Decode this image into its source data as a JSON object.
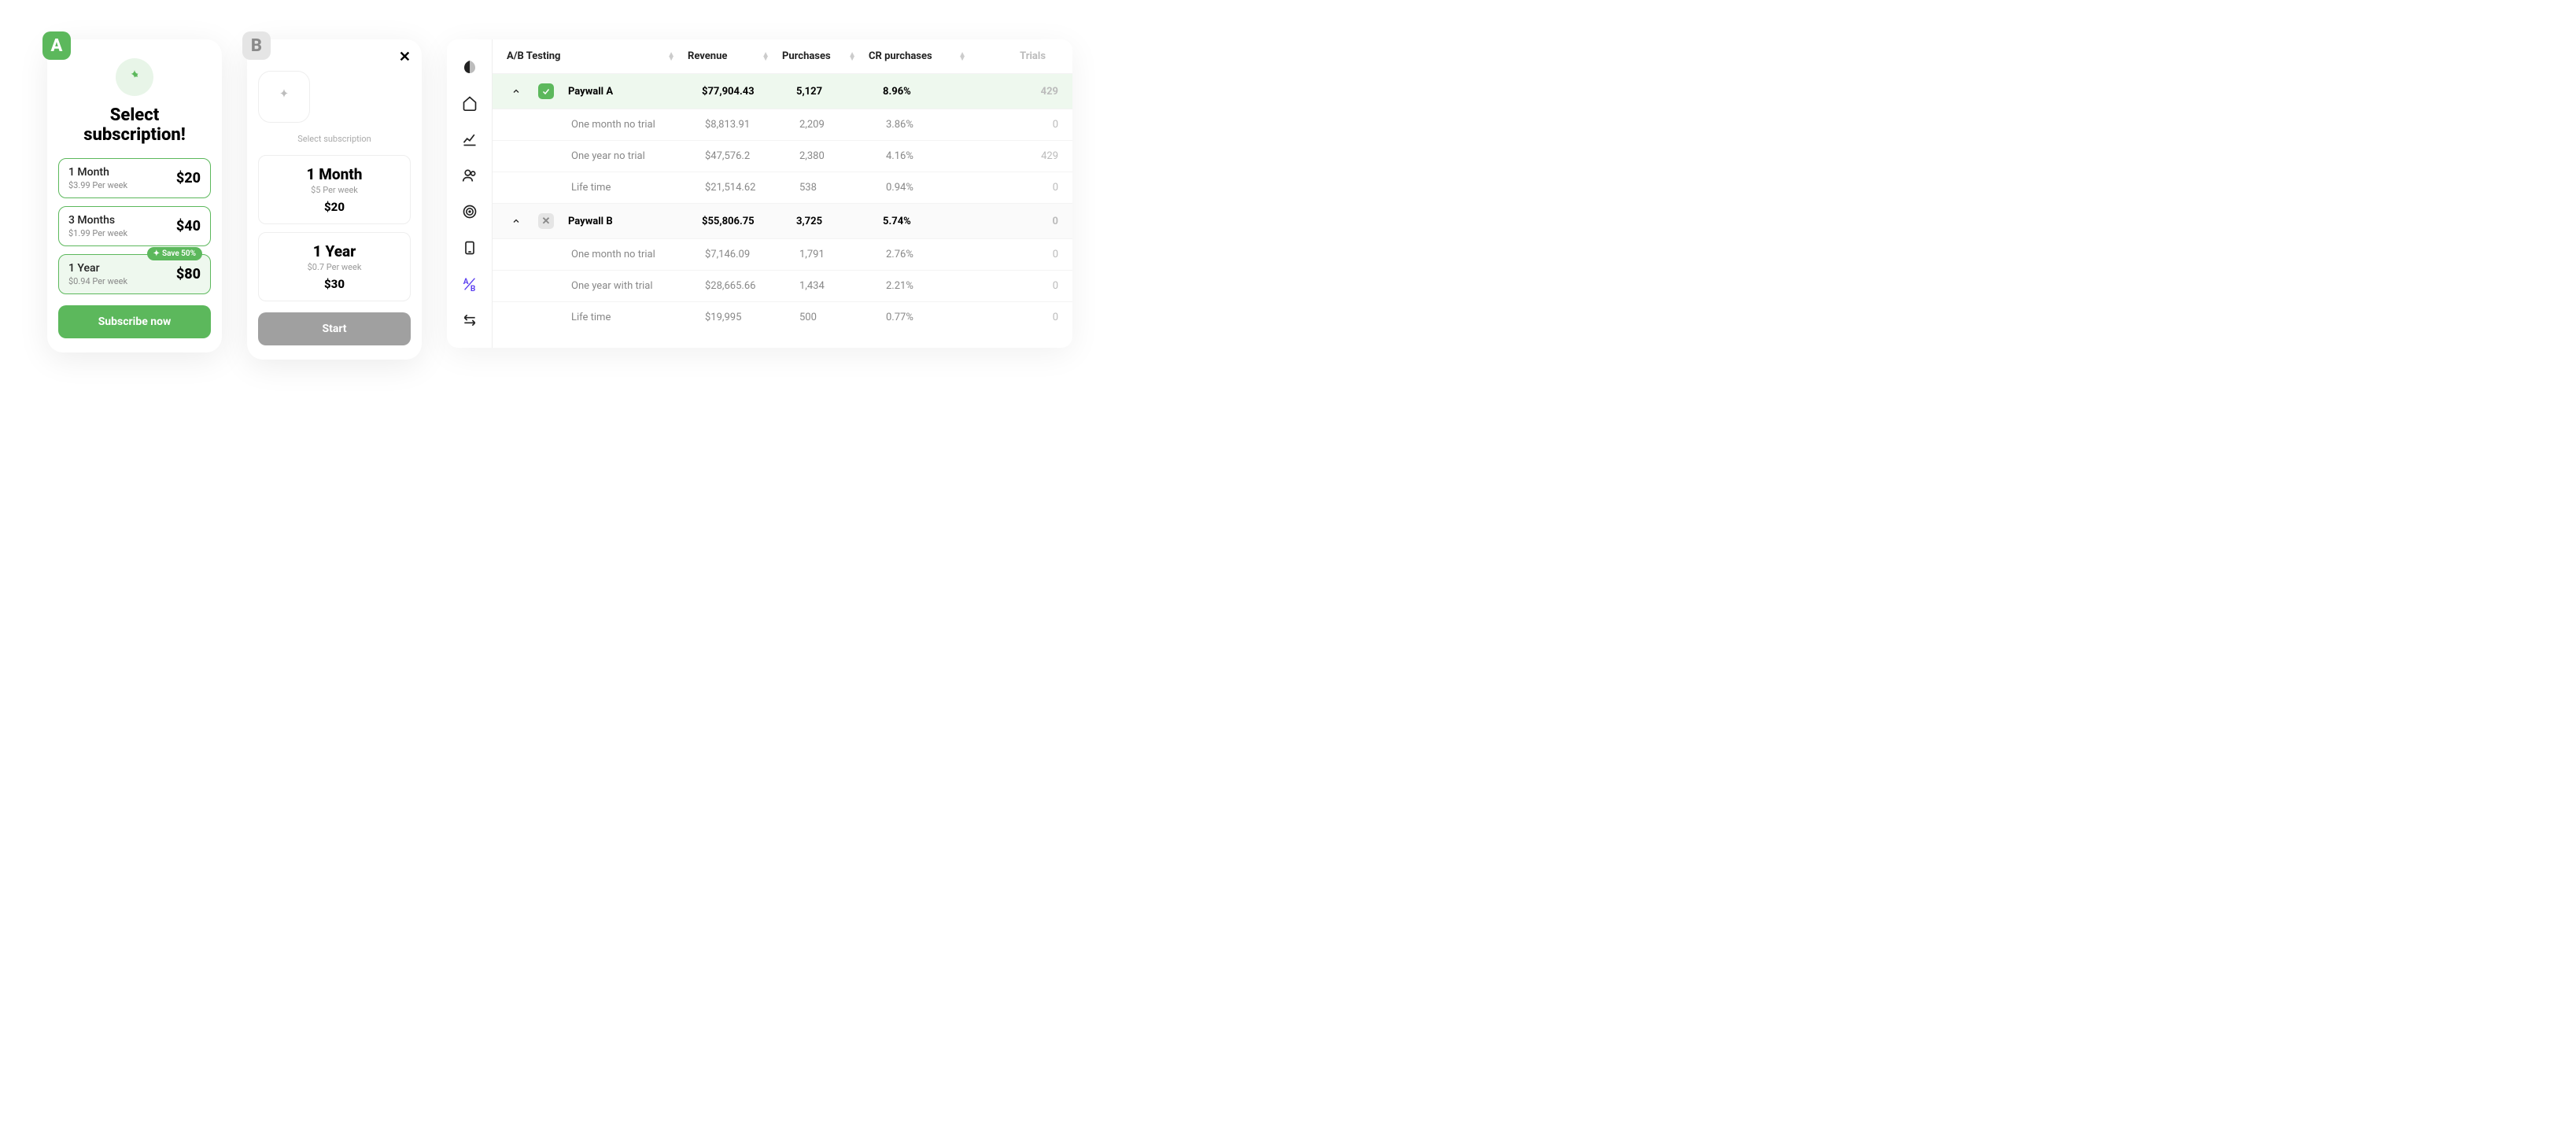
{
  "variant_a": {
    "badge": "A",
    "title_line1": "Select",
    "title_line2": "subscription!",
    "plans": [
      {
        "name": "1 Month",
        "per": "$3.99 Per week",
        "price": "$20"
      },
      {
        "name": "3 Months",
        "per": "$1.99 Per week",
        "price": "$40"
      },
      {
        "name": "1 Year",
        "per": "$0.94 Per week",
        "price": "$80",
        "save": "Save 50%"
      }
    ],
    "cta": "Subscribe now"
  },
  "variant_b": {
    "badge": "B",
    "subtitle": "Select subscription",
    "plans": [
      {
        "name": "1 Month",
        "per": "$5 Per week",
        "price": "$20"
      },
      {
        "name": "1 Year",
        "per": "$0.7 Per week",
        "price": "$30"
      }
    ],
    "cta": "Start"
  },
  "dashboard": {
    "headers": {
      "name": "A/B Testing",
      "rev": "Revenue",
      "pur": "Purchases",
      "cr": "CR purchases",
      "tr": "Trials"
    },
    "groups": [
      {
        "label": "Paywall A",
        "rev": "$77,904.43",
        "pur": "5,127",
        "cr": "8.96%",
        "tr": "429",
        "active": true,
        "rows": [
          {
            "name": "One month no trial",
            "rev": "$8,813.91",
            "pur": "2,209",
            "cr": "3.86%",
            "tr": "0"
          },
          {
            "name": "One year no trial",
            "rev": "$47,576.2",
            "pur": "2,380",
            "cr": "4.16%",
            "tr": "429"
          },
          {
            "name": "Life time",
            "rev": "$21,514.62",
            "pur": "538",
            "cr": "0.94%",
            "tr": "0"
          }
        ]
      },
      {
        "label": "Paywall B",
        "rev": "$55,806.75",
        "pur": "3,725",
        "cr": "5.74%",
        "tr": "0",
        "active": false,
        "rows": [
          {
            "name": "One month no trial",
            "rev": "$7,146.09",
            "pur": "1,791",
            "cr": "2.76%",
            "tr": "0"
          },
          {
            "name": "One year with trial",
            "rev": "$28,665.66",
            "pur": "1,434",
            "cr": "2.21%",
            "tr": "0"
          },
          {
            "name": "Life time",
            "rev": "$19,995",
            "pur": "500",
            "cr": "0.77%",
            "tr": "0"
          }
        ]
      }
    ]
  }
}
